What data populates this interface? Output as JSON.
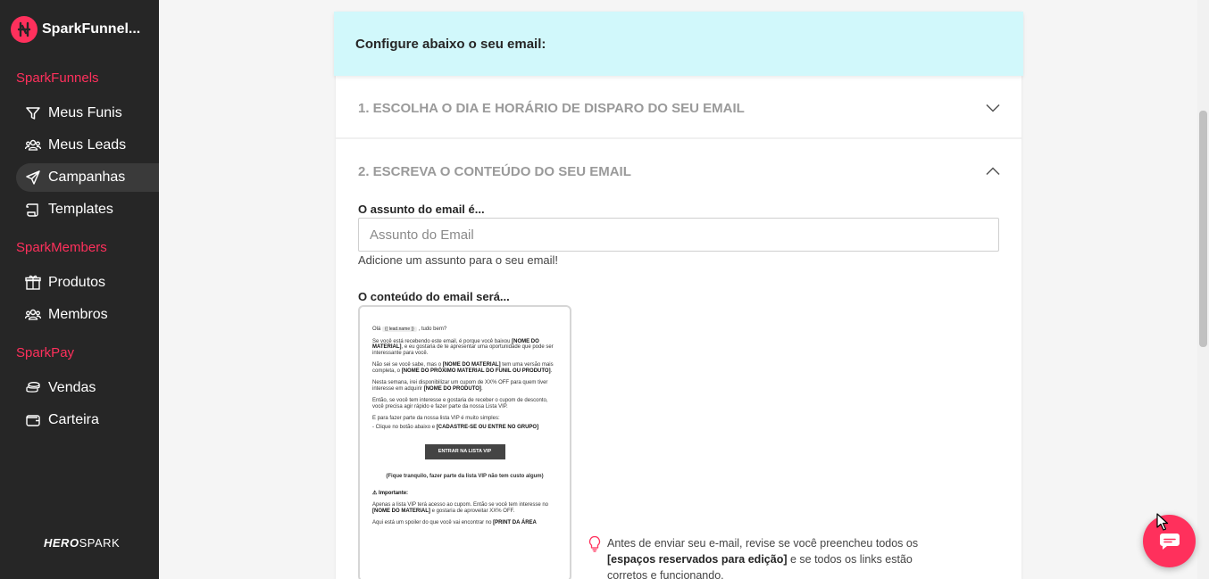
{
  "app": {
    "name": "SparkFunnel..."
  },
  "sidebar": {
    "sections": [
      {
        "title": "SparkFunnels",
        "items": [
          {
            "label": "Meus Funis",
            "icon": "filter-icon"
          },
          {
            "label": "Meus Leads",
            "icon": "users-icon"
          },
          {
            "label": "Campanhas",
            "icon": "send-icon",
            "active": true
          },
          {
            "label": "Templates",
            "icon": "scroll-icon"
          }
        ]
      },
      {
        "title": "SparkMembers",
        "items": [
          {
            "label": "Produtos",
            "icon": "box-icon"
          },
          {
            "label": "Membros",
            "icon": "users-icon"
          }
        ]
      },
      {
        "title": "SparkPay",
        "items": [
          {
            "label": "Vendas",
            "icon": "coins-icon"
          },
          {
            "label": "Carteira",
            "icon": "wallet-icon"
          }
        ]
      }
    ],
    "footer_logo": {
      "bold": "HERO",
      "rest": "SPARK"
    }
  },
  "main": {
    "header": "Configure abaixo o seu email:",
    "step1": {
      "title": "1. Escolha o dia e horário de disparo do seu email",
      "expanded": false
    },
    "step2": {
      "title": "2. Escreva o conteúdo do seu email",
      "expanded": true
    },
    "subject": {
      "label": "O assunto do email é...",
      "placeholder": "Assunto do Email",
      "value": "",
      "hint": "Adicione um assunto para o seu email!"
    },
    "content": {
      "label": "O conteúdo do email será...",
      "preview": {
        "greeting_pre": "Olá",
        "greeting_tag": "{{ lead.name }}",
        "greeting_post": ", tudo bem?",
        "p1_pre": "Se você está recebendo este email, é porque você baixou",
        "p1_bold": "[NOME DO MATERIAL]",
        "p1_post": ", e eu gostaria de te apresentar uma oportunidade que pode ser interessante para você.",
        "p2_pre": "Não sei se você sabe, mas o",
        "p2_bold1": "[NOME DO MATERIAL]",
        "p2_mid": "tem uma versão mais completa, o",
        "p2_bold2": "[NOME DO PRÓXIMO MATERIAL DO FUNIL OU PRODUTO]",
        "p2_post": ".",
        "p3_pre": "Nesta semana, irei disponibilizar um cupom de XX% OFF para quem tiver interesse em adquirir",
        "p3_bold": "[NOME DO PRODUTO]",
        "p3_post": ".",
        "p4": "Então, se você tem interesse e gostaria de receber o cupom de desconto, você precisa agir rápido e fazer parte da nossa Lista VIP.",
        "p5": "E para fazer parte da nossa lista VIP é muito simples:",
        "p6_pre": "- Clique no botão abaixo e",
        "p6_bold": "[CADASTRE-SE OU ENTRE NO GRUPO]",
        "button": "ENTRAR NA LISTA VIP",
        "note": "(Fique tranquilo, fazer parte da lista VIP não tem custo algum)",
        "important": "⚠ Importante:",
        "p7_pre": "Apenas a lista VIP terá acesso ao cupom. Então se você tem interesse no",
        "p7_bold": "[NOME DO MATERIAL]",
        "p7_post": "e gostaria de aproveitar XX% OFF.",
        "p8_pre": "Aqui está um spoiler do que você vai encontrar no",
        "p8_bold": "[PRINT DA ÁREA"
      }
    },
    "tip": {
      "pre": "Antes de enviar seu e-mail, revise se você preencheu todos os",
      "bold": "[espaços reservados para edição]",
      "post": "e se todos os links estão corretos e funcionando."
    }
  },
  "colors": {
    "brand": "#ff305c",
    "sidebar_bg": "#262626",
    "header_bg": "#d1f8fb"
  },
  "chat": {
    "icon": "chat-icon"
  }
}
